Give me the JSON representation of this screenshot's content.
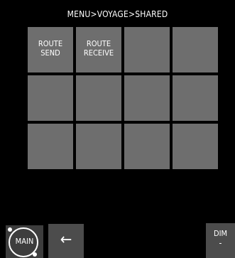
{
  "breadcrumb": "MENU>VOYAGE>SHARED",
  "tiles": [
    {
      "line1": "ROUTE",
      "line2": "SEND"
    },
    {
      "line1": "ROUTE",
      "line2": "RECEIVE"
    },
    {
      "line1": "",
      "line2": ""
    },
    {
      "line1": "",
      "line2": ""
    },
    {
      "line1": "",
      "line2": ""
    },
    {
      "line1": "",
      "line2": ""
    },
    {
      "line1": "",
      "line2": ""
    },
    {
      "line1": "",
      "line2": ""
    },
    {
      "line1": "",
      "line2": ""
    },
    {
      "line1": "",
      "line2": ""
    },
    {
      "line1": "",
      "line2": ""
    },
    {
      "line1": "",
      "line2": ""
    }
  ],
  "bottom": {
    "main_label": "MAIN",
    "back_icon": "left-arrow-icon",
    "back_glyph": "←",
    "dim_label": "DIM",
    "dim_value": "-"
  },
  "colors": {
    "background": "#000000",
    "tile": "#6e6e6e",
    "button": "#4c4c4c",
    "text": "#ffffff"
  }
}
